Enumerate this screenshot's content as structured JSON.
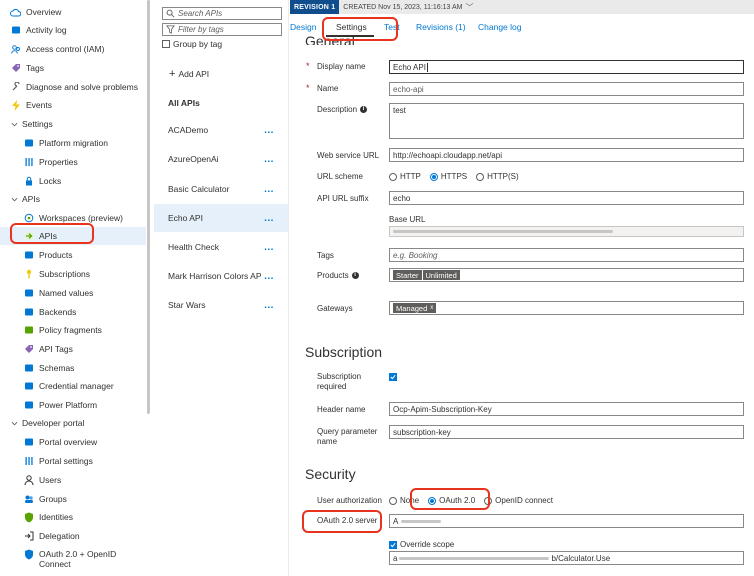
{
  "nav": {
    "items": [
      {
        "label": "Overview",
        "icon": "cloud-icon",
        "level": "top",
        "color": "#0078d4"
      },
      {
        "label": "Activity log",
        "icon": "activity-log-icon",
        "level": "top",
        "color": "#0078d4"
      },
      {
        "label": "Access control (IAM)",
        "icon": "people-icon",
        "level": "top",
        "color": "#0078d4"
      },
      {
        "label": "Tags",
        "icon": "tag-icon",
        "level": "top",
        "color": "#8764b8"
      },
      {
        "label": "Diagnose and solve problems",
        "icon": "wrench-icon",
        "level": "top",
        "color": "#605e5c"
      },
      {
        "label": "Events",
        "icon": "lightning-icon",
        "level": "top",
        "color": "#f2c811"
      },
      {
        "label": "Settings",
        "icon": "chevron-down-icon",
        "level": "section"
      },
      {
        "label": "Platform migration",
        "icon": "migration-icon",
        "level": "child",
        "color": "#0078d4"
      },
      {
        "label": "Properties",
        "icon": "properties-icon",
        "level": "child",
        "color": "#0078d4"
      },
      {
        "label": "Locks",
        "icon": "lock-icon",
        "level": "child",
        "color": "#0078d4"
      },
      {
        "label": "APIs",
        "icon": "chevron-down-icon",
        "level": "section"
      },
      {
        "label": "Workspaces (preview)",
        "icon": "workspaces-icon",
        "level": "child",
        "color": "#0078d4"
      },
      {
        "label": "APIs",
        "icon": "api-arrow-icon",
        "level": "child",
        "color": "#57a300",
        "selected": true
      },
      {
        "label": "Products",
        "icon": "products-icon",
        "level": "child",
        "color": "#0078d4"
      },
      {
        "label": "Subscriptions",
        "icon": "key-icon",
        "level": "child",
        "color": "#f2c811"
      },
      {
        "label": "Named values",
        "icon": "named-values-icon",
        "level": "child",
        "color": "#0078d4"
      },
      {
        "label": "Backends",
        "icon": "backends-icon",
        "level": "child",
        "color": "#0078d4"
      },
      {
        "label": "Policy fragments",
        "icon": "policy-fragments-icon",
        "level": "child",
        "color": "#57a300"
      },
      {
        "label": "API Tags",
        "icon": "tag-icon",
        "level": "child",
        "color": "#8764b8"
      },
      {
        "label": "Schemas",
        "icon": "schemas-icon",
        "level": "child",
        "color": "#0078d4"
      },
      {
        "label": "Credential manager",
        "icon": "credential-icon",
        "level": "child",
        "color": "#0078d4"
      },
      {
        "label": "Power Platform",
        "icon": "power-platform-icon",
        "level": "child",
        "color": "#0078d4"
      },
      {
        "label": "Developer portal",
        "icon": "chevron-down-icon",
        "level": "section"
      },
      {
        "label": "Portal overview",
        "icon": "portal-overview-icon",
        "level": "child",
        "color": "#0078d4"
      },
      {
        "label": "Portal settings",
        "icon": "portal-settings-icon",
        "level": "child",
        "color": "#0078d4"
      },
      {
        "label": "Users",
        "icon": "user-icon",
        "level": "child",
        "color": "#0078d4"
      },
      {
        "label": "Groups",
        "icon": "groups-icon",
        "level": "child",
        "color": "#0078d4"
      },
      {
        "label": "Identities",
        "icon": "shield-icon",
        "level": "child",
        "color": "#57a300"
      },
      {
        "label": "Delegation",
        "icon": "delegation-icon",
        "level": "child",
        "color": "#323130"
      },
      {
        "label": "OAuth 2.0 + OpenID Connect",
        "icon": "shield-icon",
        "level": "child",
        "color": "#0078d4"
      }
    ]
  },
  "apilist": {
    "search_placeholder": "Search APIs",
    "filter_placeholder": "Filter by tags",
    "group_by_tag": "Group by tag",
    "add_api": "Add API",
    "all_apis": "All APIs",
    "apis": [
      {
        "name": "ACADemo",
        "selected": false
      },
      {
        "name": "AzureOpenAi",
        "selected": false
      },
      {
        "name": "Basic Calculator",
        "selected": false
      },
      {
        "name": "Echo API",
        "selected": true
      },
      {
        "name": "Health Check",
        "selected": false
      },
      {
        "name": "Mark Harrison Colors API",
        "selected": false
      },
      {
        "name": "Star Wars",
        "selected": false
      }
    ],
    "more": "..."
  },
  "revision": {
    "badge": "REVISION 1",
    "created": "CREATED Nov 15, 2023, 11:16:13 AM",
    "chevron": "chevron-down-icon"
  },
  "tabs": [
    {
      "label": "Design",
      "active": false
    },
    {
      "label": "Settings",
      "active": true
    },
    {
      "label": "Test",
      "active": false
    },
    {
      "label": "Revisions (1)",
      "active": false
    },
    {
      "label": "Change log",
      "active": false
    }
  ],
  "general": {
    "heading": "General",
    "display_name_label": "Display name",
    "display_name_value": "Echo API",
    "name_label": "Name",
    "name_value": "echo-api",
    "description_label": "Description",
    "description_value": "test",
    "web_service_url_label": "Web service URL",
    "web_service_url_value": "http://echoapi.cloudapp.net/api",
    "url_scheme_label": "URL scheme",
    "url_schemes": [
      {
        "label": "HTTP",
        "selected": false
      },
      {
        "label": "HTTPS",
        "selected": true
      },
      {
        "label": "HTTP(S)",
        "selected": false
      }
    ],
    "api_url_suffix_label": "API URL suffix",
    "api_url_suffix_value": "echo",
    "base_url_label": "Base URL",
    "tags_label": "Tags",
    "tags_placeholder": "e.g. Booking",
    "products_label": "Products",
    "products": [
      "Starter",
      "Unlimited"
    ],
    "gateways_label": "Gateways",
    "gateways": [
      "Managed"
    ],
    "gateway_remove": "x"
  },
  "subscription": {
    "heading": "Subscription",
    "required_label": "Subscription required",
    "required_checked": true,
    "header_name_label": "Header name",
    "header_name_value": "Ocp-Apim-Subscription-Key",
    "query_param_label": "Query parameter name",
    "query_param_value": "subscription-key"
  },
  "security": {
    "heading": "Security",
    "user_auth_label": "User authorization",
    "auth_options": [
      {
        "label": "None",
        "selected": false
      },
      {
        "label": "OAuth 2.0",
        "selected": true
      },
      {
        "label": "OpenID connect",
        "selected": false
      }
    ],
    "oauth_server_label": "OAuth 2.0 server",
    "oauth_server_value": "A",
    "override_scope_label": "Override scope",
    "override_scope_checked": true,
    "scope_value_prefix": "a",
    "scope_value_suffix": "b/Calculator.Use"
  },
  "colors": {
    "accent": "#0078d4",
    "highlight": "#e8341f",
    "revision_badge": "#0f4d8c",
    "selected_row": "#e6f0fa",
    "required": "#a4262c"
  }
}
